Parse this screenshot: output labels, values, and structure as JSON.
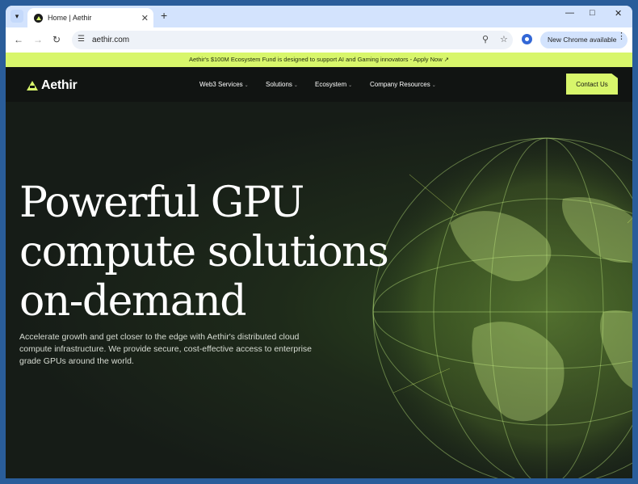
{
  "browser": {
    "tab_title": "Home | Aethir",
    "url": "aethir.com",
    "update_label": "New Chrome available"
  },
  "announcement": "Aethir's $100M Ecosystem Fund is designed to support AI and Gaming innovators - Apply Now ↗",
  "nav": {
    "logo": "Aethir",
    "items": [
      {
        "label": "Web3 Services"
      },
      {
        "label": "Solutions"
      },
      {
        "label": "Ecosystem"
      },
      {
        "label": "Company Resources"
      }
    ],
    "cta": "Contact Us"
  },
  "hero": {
    "title_line1": "Powerful GPU",
    "title_line2": "compute solutions",
    "title_line3": "on-demand",
    "subtitle": "Accelerate growth and get closer to the edge with Aethir's distributed cloud compute infrastructure. We provide secure, cost-effective access to enterprise grade GPUs around the world."
  },
  "colors": {
    "accent": "#d8f66b",
    "nav_bg": "#111412",
    "browser_frame": "#d3e3fd"
  }
}
